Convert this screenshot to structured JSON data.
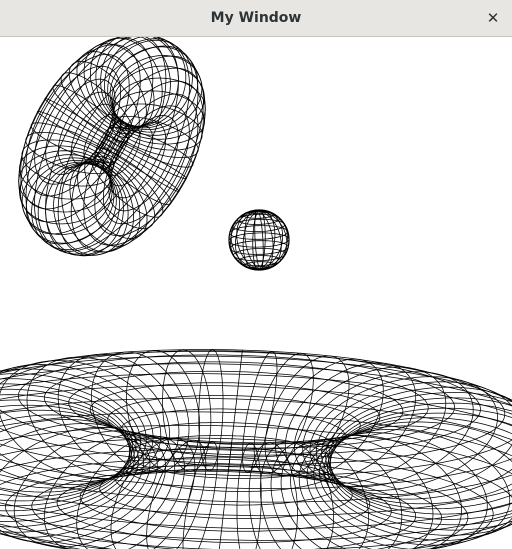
{
  "window": {
    "title": "My Window",
    "close_glyph": "✕"
  },
  "icons": {
    "close": "close-icon"
  },
  "scene": {
    "background": "#ffffff",
    "line_color": "#000000",
    "objects": [
      "torus",
      "sphere",
      "torus"
    ]
  }
}
